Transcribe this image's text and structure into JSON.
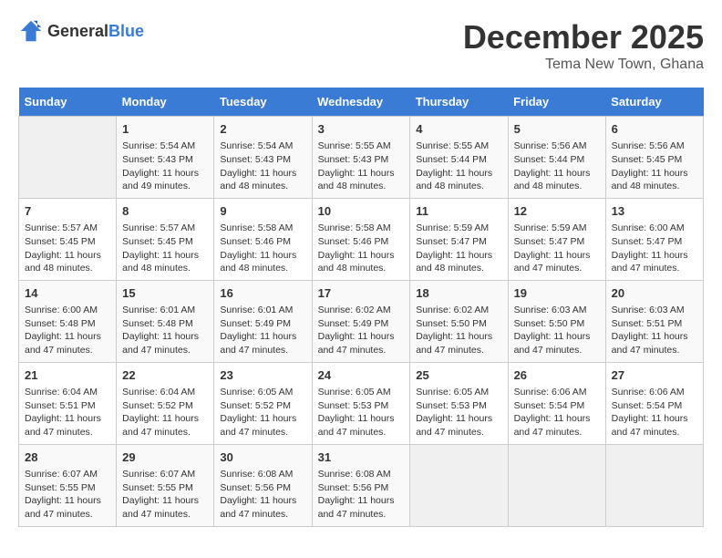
{
  "header": {
    "logo_general": "General",
    "logo_blue": "Blue",
    "month": "December 2025",
    "location": "Tema New Town, Ghana"
  },
  "days_of_week": [
    "Sunday",
    "Monday",
    "Tuesday",
    "Wednesday",
    "Thursday",
    "Friday",
    "Saturday"
  ],
  "weeks": [
    [
      {
        "day": "",
        "info": ""
      },
      {
        "day": "1",
        "info": "Sunrise: 5:54 AM\nSunset: 5:43 PM\nDaylight: 11 hours and 49 minutes."
      },
      {
        "day": "2",
        "info": "Sunrise: 5:54 AM\nSunset: 5:43 PM\nDaylight: 11 hours and 48 minutes."
      },
      {
        "day": "3",
        "info": "Sunrise: 5:55 AM\nSunset: 5:43 PM\nDaylight: 11 hours and 48 minutes."
      },
      {
        "day": "4",
        "info": "Sunrise: 5:55 AM\nSunset: 5:44 PM\nDaylight: 11 hours and 48 minutes."
      },
      {
        "day": "5",
        "info": "Sunrise: 5:56 AM\nSunset: 5:44 PM\nDaylight: 11 hours and 48 minutes."
      },
      {
        "day": "6",
        "info": "Sunrise: 5:56 AM\nSunset: 5:45 PM\nDaylight: 11 hours and 48 minutes."
      }
    ],
    [
      {
        "day": "7",
        "info": "Sunrise: 5:57 AM\nSunset: 5:45 PM\nDaylight: 11 hours and 48 minutes."
      },
      {
        "day": "8",
        "info": "Sunrise: 5:57 AM\nSunset: 5:45 PM\nDaylight: 11 hours and 48 minutes."
      },
      {
        "day": "9",
        "info": "Sunrise: 5:58 AM\nSunset: 5:46 PM\nDaylight: 11 hours and 48 minutes."
      },
      {
        "day": "10",
        "info": "Sunrise: 5:58 AM\nSunset: 5:46 PM\nDaylight: 11 hours and 48 minutes."
      },
      {
        "day": "11",
        "info": "Sunrise: 5:59 AM\nSunset: 5:47 PM\nDaylight: 11 hours and 48 minutes."
      },
      {
        "day": "12",
        "info": "Sunrise: 5:59 AM\nSunset: 5:47 PM\nDaylight: 11 hours and 47 minutes."
      },
      {
        "day": "13",
        "info": "Sunrise: 6:00 AM\nSunset: 5:47 PM\nDaylight: 11 hours and 47 minutes."
      }
    ],
    [
      {
        "day": "14",
        "info": "Sunrise: 6:00 AM\nSunset: 5:48 PM\nDaylight: 11 hours and 47 minutes."
      },
      {
        "day": "15",
        "info": "Sunrise: 6:01 AM\nSunset: 5:48 PM\nDaylight: 11 hours and 47 minutes."
      },
      {
        "day": "16",
        "info": "Sunrise: 6:01 AM\nSunset: 5:49 PM\nDaylight: 11 hours and 47 minutes."
      },
      {
        "day": "17",
        "info": "Sunrise: 6:02 AM\nSunset: 5:49 PM\nDaylight: 11 hours and 47 minutes."
      },
      {
        "day": "18",
        "info": "Sunrise: 6:02 AM\nSunset: 5:50 PM\nDaylight: 11 hours and 47 minutes."
      },
      {
        "day": "19",
        "info": "Sunrise: 6:03 AM\nSunset: 5:50 PM\nDaylight: 11 hours and 47 minutes."
      },
      {
        "day": "20",
        "info": "Sunrise: 6:03 AM\nSunset: 5:51 PM\nDaylight: 11 hours and 47 minutes."
      }
    ],
    [
      {
        "day": "21",
        "info": "Sunrise: 6:04 AM\nSunset: 5:51 PM\nDaylight: 11 hours and 47 minutes."
      },
      {
        "day": "22",
        "info": "Sunrise: 6:04 AM\nSunset: 5:52 PM\nDaylight: 11 hours and 47 minutes."
      },
      {
        "day": "23",
        "info": "Sunrise: 6:05 AM\nSunset: 5:52 PM\nDaylight: 11 hours and 47 minutes."
      },
      {
        "day": "24",
        "info": "Sunrise: 6:05 AM\nSunset: 5:53 PM\nDaylight: 11 hours and 47 minutes."
      },
      {
        "day": "25",
        "info": "Sunrise: 6:05 AM\nSunset: 5:53 PM\nDaylight: 11 hours and 47 minutes."
      },
      {
        "day": "26",
        "info": "Sunrise: 6:06 AM\nSunset: 5:54 PM\nDaylight: 11 hours and 47 minutes."
      },
      {
        "day": "27",
        "info": "Sunrise: 6:06 AM\nSunset: 5:54 PM\nDaylight: 11 hours and 47 minutes."
      }
    ],
    [
      {
        "day": "28",
        "info": "Sunrise: 6:07 AM\nSunset: 5:55 PM\nDaylight: 11 hours and 47 minutes."
      },
      {
        "day": "29",
        "info": "Sunrise: 6:07 AM\nSunset: 5:55 PM\nDaylight: 11 hours and 47 minutes."
      },
      {
        "day": "30",
        "info": "Sunrise: 6:08 AM\nSunset: 5:56 PM\nDaylight: 11 hours and 47 minutes."
      },
      {
        "day": "31",
        "info": "Sunrise: 6:08 AM\nSunset: 5:56 PM\nDaylight: 11 hours and 47 minutes."
      },
      {
        "day": "",
        "info": ""
      },
      {
        "day": "",
        "info": ""
      },
      {
        "day": "",
        "info": ""
      }
    ]
  ]
}
